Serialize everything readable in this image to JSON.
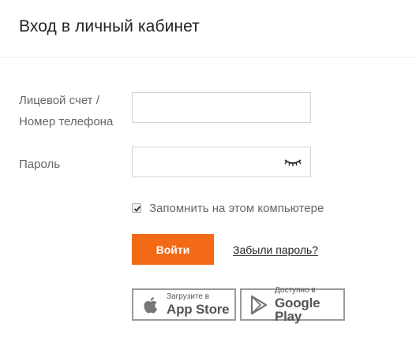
{
  "header": {
    "title": "Вход в личный кабинет"
  },
  "form": {
    "account_label_line1": "Лицевой счет /",
    "account_label_line2": "Номер телефона",
    "account_value": "",
    "password_label": "Пароль",
    "password_value": "",
    "remember_label": "Запомнить на этом компьютере",
    "remember_checked": true,
    "login_label": "Войти",
    "forgot_label": "Забыли пароль?"
  },
  "stores": {
    "apple": {
      "small": "Загрузите в",
      "big": "App Store"
    },
    "google": {
      "small": "Доступно в",
      "big": "Google Play"
    }
  },
  "colors": {
    "accent": "#f26a16",
    "border": "#d3d3d3"
  }
}
